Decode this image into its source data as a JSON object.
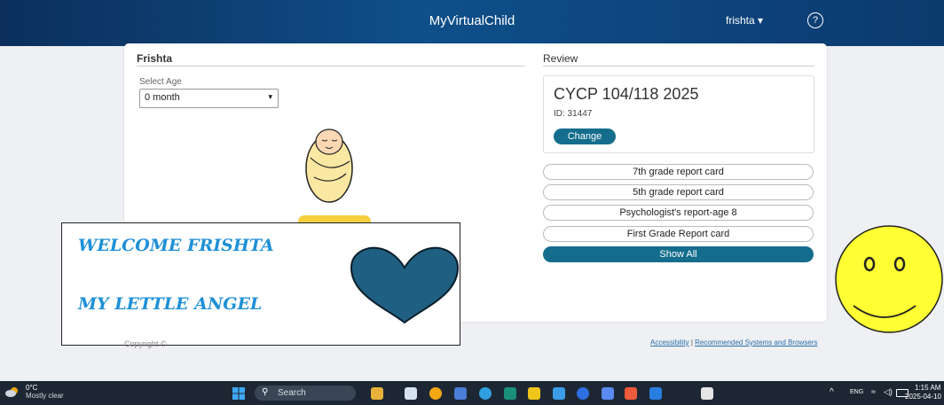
{
  "header": {
    "title": "MyVirtualChild",
    "user": "frishta ▾",
    "help_glyph": "?"
  },
  "left_panel": {
    "child_name": "Frishta",
    "age_label": "Select Age",
    "age_value": "0 month",
    "age_caret": "▾"
  },
  "review": {
    "title": "Review",
    "course": "CYCP 104/118 2025",
    "id_text": "ID: 31447",
    "change_label": "Change",
    "reports": [
      "7th grade report card",
      "5th grade report card",
      "Psychologist's report-age 8",
      "First Grade Report card"
    ],
    "show_all_label": "Show All"
  },
  "overlay": {
    "line1": "WELCOME FRISHTA",
    "line2": "MY LETTLE ANGEL",
    "heart_color": "#1f5f82",
    "smiley_color": "#ffff33"
  },
  "footer": {
    "copyright": "Copyright ©",
    "accessibility": "Accessibility",
    "separator": "|",
    "recommended": "Recommended Systems and Browsers"
  },
  "taskbar": {
    "temperature": "0°C",
    "condition": "Mostly clear",
    "search_glyph": "⚲",
    "search_placeholder": "Search",
    "chevron": "^",
    "language": "ENG",
    "wifi_glyph": "≈",
    "volume_glyph": "◁)",
    "time": "1:15 AM",
    "date": "2025-04-10",
    "app_colors": [
      "#e8b23a",
      "#d6e2ef",
      "#f3a712",
      "#4a7ed8",
      "#2f9fe0",
      "#1a8f7a",
      "#f0c419",
      "#3b9de8",
      "#2f6fe3",
      "#5a8bf0",
      "#f05a3c",
      "#2a7de1",
      "#e5e5e5"
    ]
  }
}
